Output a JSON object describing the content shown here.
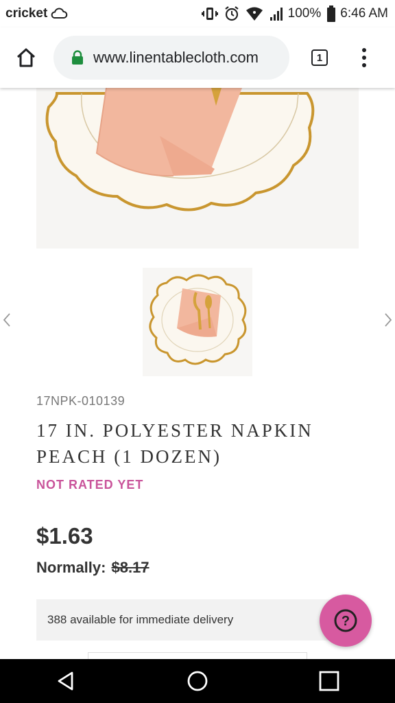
{
  "status_bar": {
    "carrier": "cricket",
    "battery": "100%",
    "time": "6:46 AM",
    "icons": [
      "cloud-icon",
      "vibrate-icon",
      "alarm-icon",
      "wifi-icon",
      "signal-icon",
      "battery-icon"
    ]
  },
  "browser": {
    "url": "www.linentablecloth.com",
    "tab_count": "1",
    "icons": [
      "home-icon",
      "lock-icon",
      "tabs-icon",
      "menu-icon"
    ]
  },
  "product": {
    "sku": "17NPK-010139",
    "title": "17 IN. POLYESTER NAPKIN PEACH (1 DOZEN)",
    "rating": "NOT RATED YET",
    "price": "$1.63",
    "normally_label": "Normally:",
    "normally_price": "$8.17",
    "availability": "388 available for immediate delivery"
  },
  "help": {
    "label": "?"
  },
  "colors": {
    "accent": "#c9539a",
    "help_button": "#d75aa0",
    "napkin": "#f2b79e",
    "gold": "#c9962f"
  }
}
